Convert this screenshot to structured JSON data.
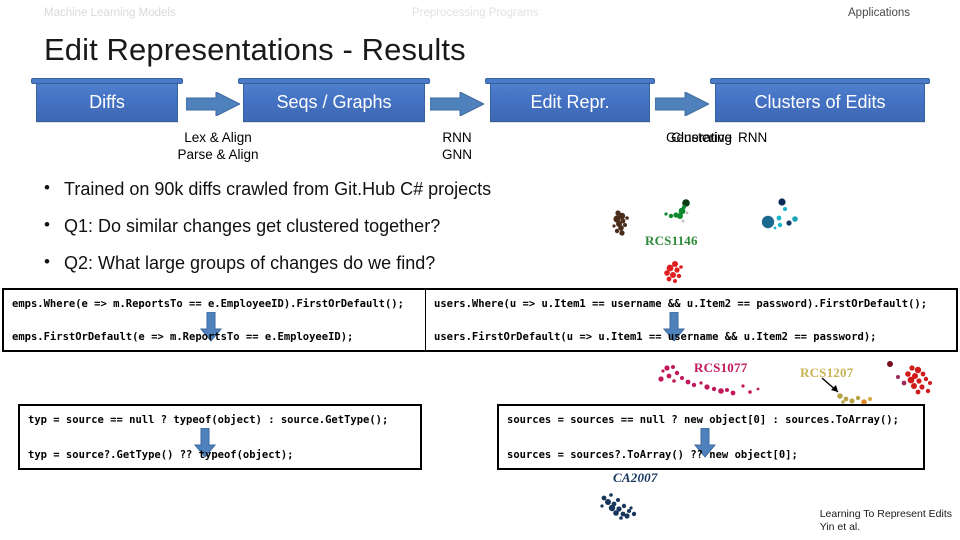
{
  "header": {
    "left_label": "Machine Learning Models",
    "center_label": "Preprocessing Programs",
    "right_label": "Applications"
  },
  "title": "Edit Representations - Results",
  "pipeline": {
    "boxes": [
      {
        "label": "Diffs"
      },
      {
        "label": "Seqs / Graphs"
      },
      {
        "label": "Edit Repr."
      },
      {
        "label": "Clusters of Edits"
      }
    ],
    "arrow_labels": [
      {
        "line1": "Lex & Align",
        "line2": "Parse & Align"
      },
      {
        "line1": "RNN",
        "line2": "GNN"
      },
      {
        "overlap_a": "Clustering",
        "overlap_b": "Generative",
        "tail": "RNN"
      }
    ]
  },
  "bullets": [
    "Trained on 90k diffs crawled from Git.Hub C# projects",
    "Q1: Do similar changes get clustered together?",
    "Q2: What large groups of changes do we find?"
  ],
  "code_boxes": [
    {
      "before": "emps.Where(e => m.ReportsTo == e.EmployeeID).FirstOrDefault();",
      "after": "emps.FirstOrDefault(e => m.ReportsTo == e.EmployeeID);"
    },
    {
      "before": "users.Where(u => u.Item1 == username && u.Item2 == password).FirstOrDefault();",
      "after": "users.FirstOrDefault(u => u.Item1 == username && u.Item2 == password);"
    },
    {
      "before": "typ = source == null ? typeof(object) : source.GetType();",
      "after": "typ = source?.GetType() ?? typeof(object);"
    },
    {
      "before": "sources = sources == null ? new object[0] : sources.ToArray();",
      "after": "sources = sources?.ToArray() ?? new object[0];"
    }
  ],
  "cluster_labels": [
    {
      "text": "RCS1146",
      "color": "#2e8b3a"
    },
    {
      "text": "RCS1077",
      "color": "#c2185b"
    },
    {
      "text": "RCS1207",
      "color": "#c9b458"
    },
    {
      "text": "CA2007",
      "color": "#16365c"
    }
  ],
  "credit": {
    "line1": "Learning To Represent Edits",
    "line2": "Yin et al."
  },
  "colors": {
    "box_blue": "#4472c4",
    "arrow_blue": "#4f81bd",
    "box_border": "#36609f",
    "header_gray": "#d9d9d9"
  }
}
